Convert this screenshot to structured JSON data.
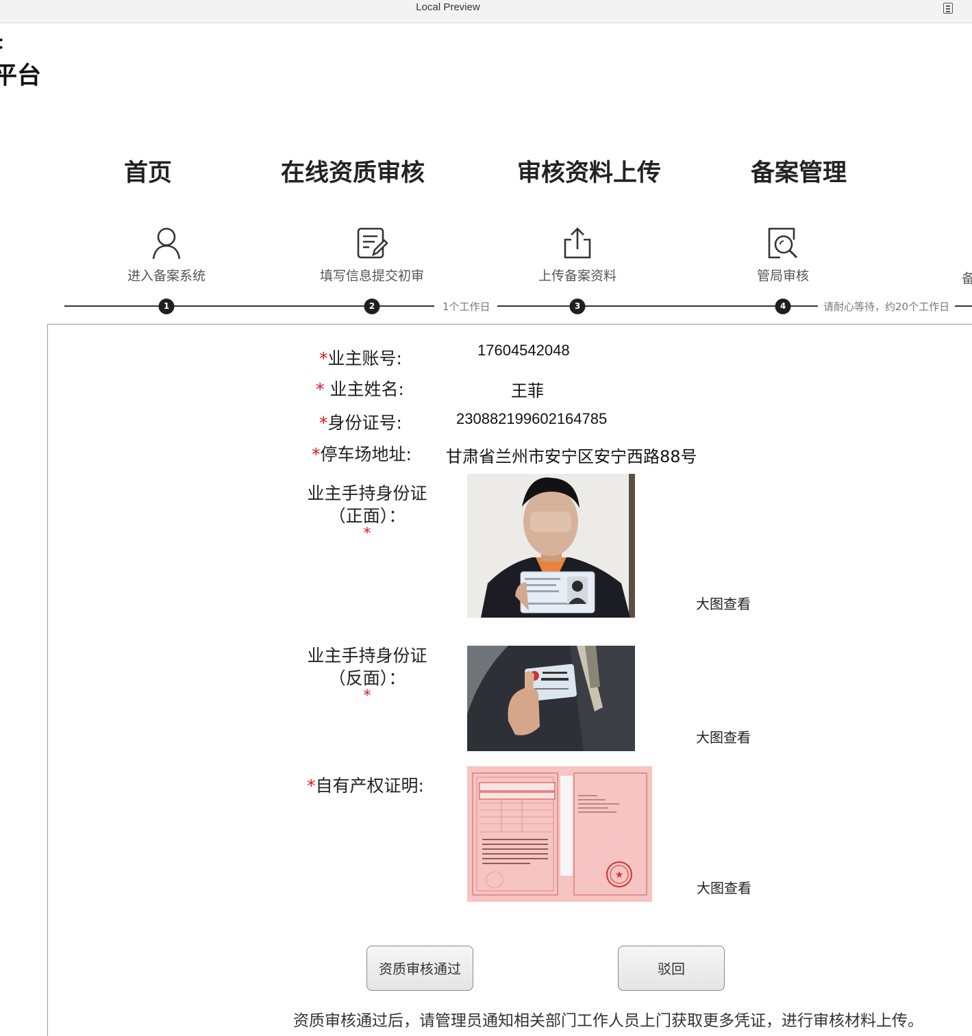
{
  "window": {
    "title": "Local Preview",
    "menu_icon": "document-list-icon"
  },
  "brand": {
    "line1": "：",
    "line2": "平台"
  },
  "nav": [
    "首页",
    "在线资质审核",
    "审核资料上传",
    "备案管理"
  ],
  "steps": [
    {
      "icon": "user-icon",
      "label": "进入备案系统",
      "number": "1"
    },
    {
      "icon": "edit-form-icon",
      "label": "填写信息提交初审",
      "number": "2"
    },
    {
      "icon": "upload-icon",
      "label": "上传备案资料",
      "number": "3"
    },
    {
      "icon": "review-search-icon",
      "label": "管局审核",
      "number": "4"
    },
    {
      "label": "备"
    }
  ],
  "step_notes": [
    "1个工作日",
    "请耐心等待，约20个工作日"
  ],
  "form": {
    "required_mark": "*",
    "owner_account": {
      "label": "业主账号:",
      "value": "17604542048"
    },
    "owner_name": {
      "label": " 业主姓名:",
      "value": "王菲"
    },
    "id_number": {
      "label": "身份证号:",
      "value": "230882199602164785"
    },
    "parking_address": {
      "label": "停车场地址:",
      "value": "甘肃省兰州市安宁区安宁西路88号"
    }
  },
  "documents": [
    {
      "label_line1": "业主手持身份证",
      "label_line2": "（正面）：",
      "view_link": "大图查看"
    },
    {
      "label_line1": "业主手持身份证",
      "label_line2": "（反面）：",
      "view_link": "大图查看"
    },
    {
      "label": "自有产权证明:",
      "view_link": "大图查看"
    }
  ],
  "actions": {
    "approve": "资质审核通过",
    "reject": "驳回"
  },
  "footer_note": "资质审核通过后，请管理员通知相关部门工作人员上门获取更多凭证，进行审核材料上传。",
  "colors": {
    "required": "#e0141e",
    "step_dot": "#1f1f1f",
    "certificate_pink": "#f6c4c2"
  }
}
